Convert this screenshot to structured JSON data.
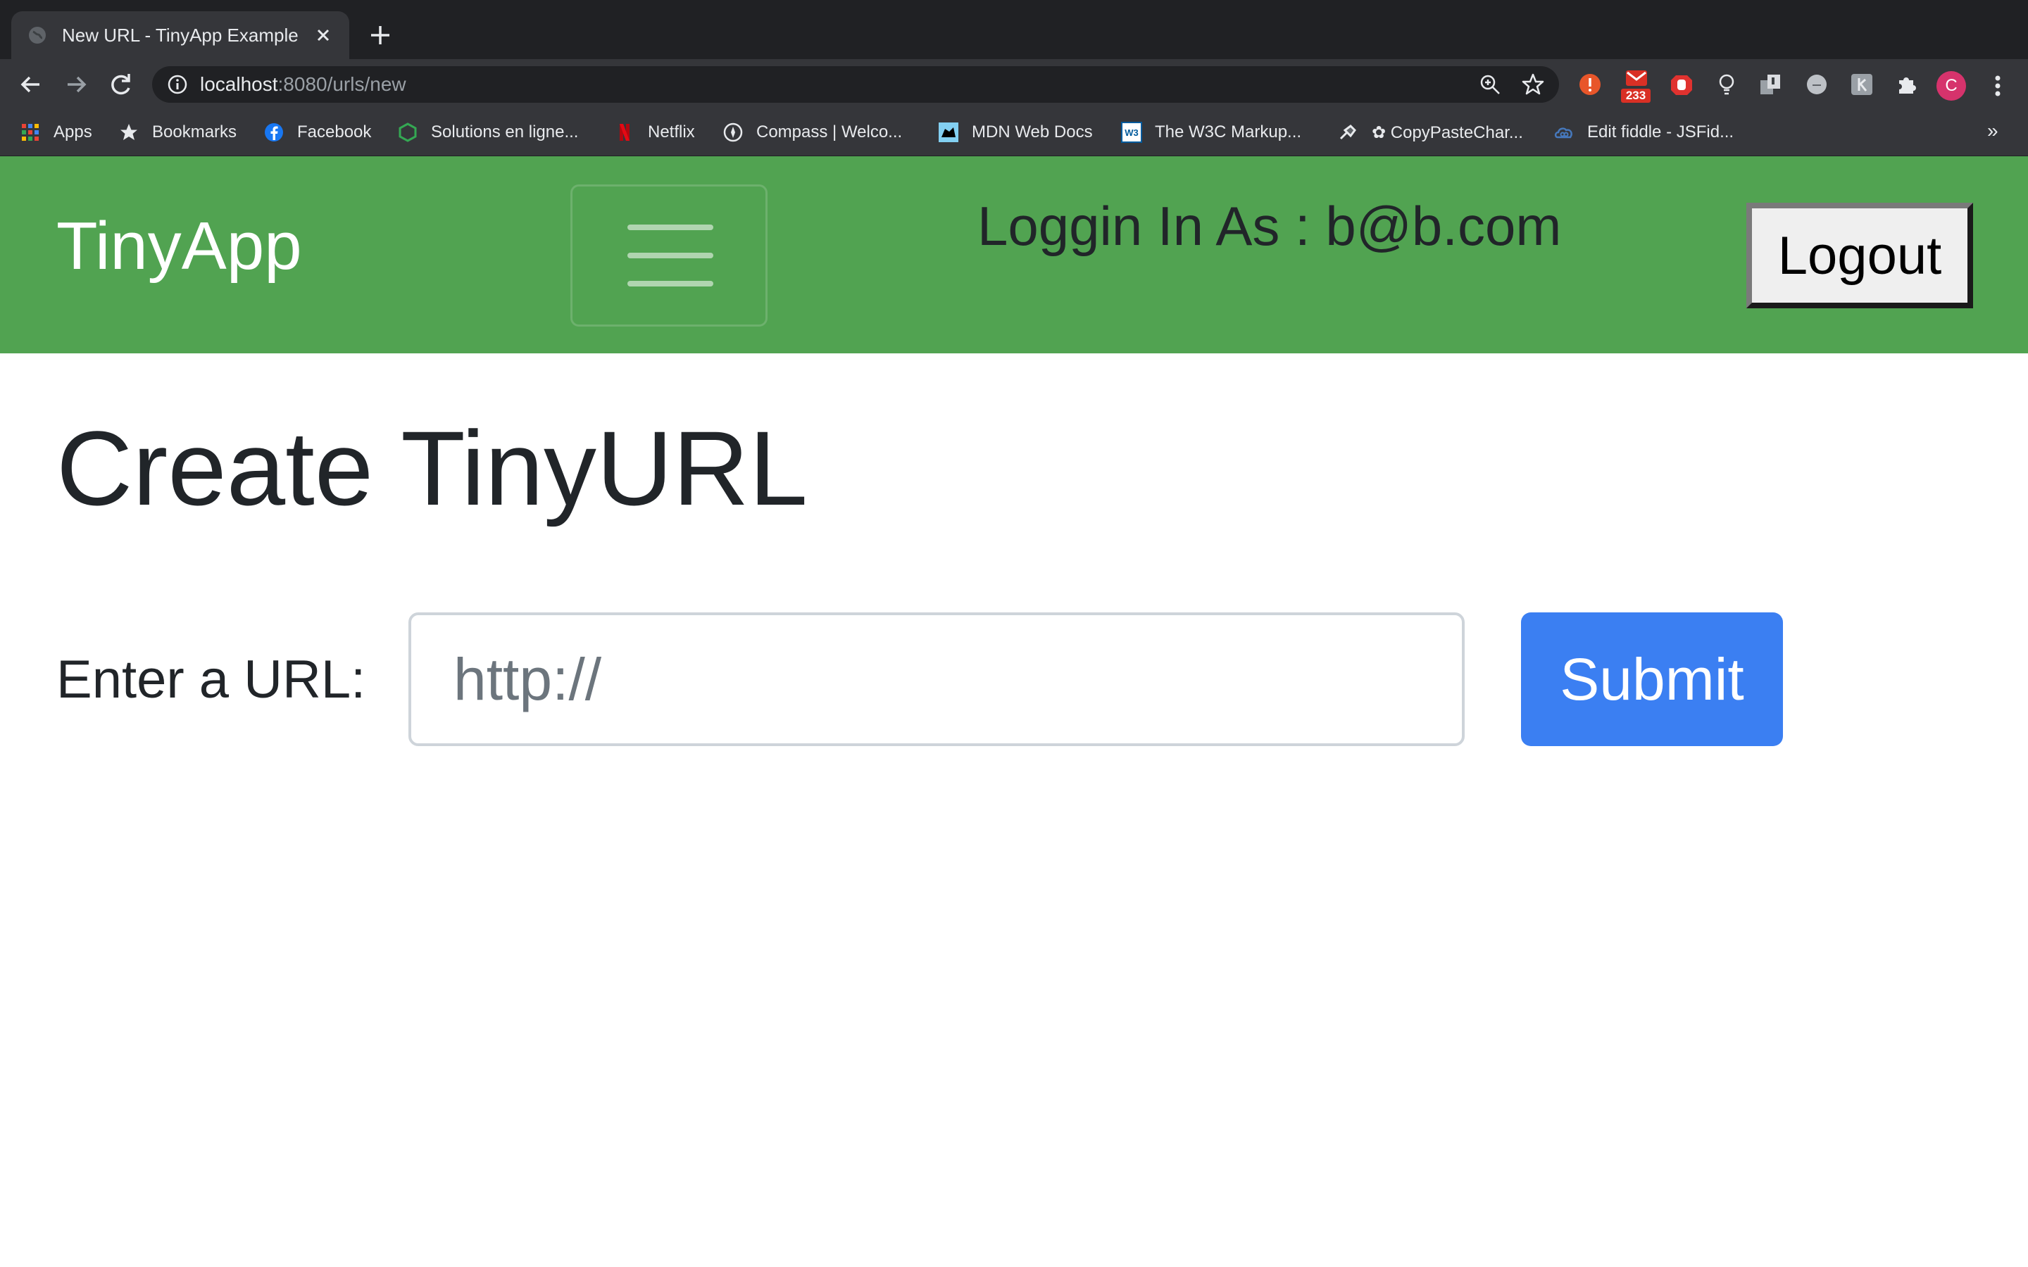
{
  "browser": {
    "tab_title": "New URL - TinyApp Example",
    "address": {
      "host": "localhost",
      "rest": ":8080/urls/new"
    },
    "extensions": [
      "alert-extension-icon",
      "mail-extension-icon",
      "hand-extension-icon",
      "bulb-extension-icon",
      "page-extension-icon",
      "circle-extension-icon",
      "k-extension-icon",
      "puzzle-icon"
    ],
    "mail_badge": "233",
    "profile_initial": "C",
    "bookmarks": [
      {
        "label": "Apps",
        "icon": "apps-grid-icon"
      },
      {
        "label": "Bookmarks",
        "icon": "star-icon"
      },
      {
        "label": "Facebook",
        "icon": "facebook-icon"
      },
      {
        "label": "Solutions en ligne...",
        "icon": "hexagon-icon"
      },
      {
        "label": "Netflix",
        "icon": "netflix-icon"
      },
      {
        "label": "Compass | Welco...",
        "icon": "compass-icon"
      },
      {
        "label": "MDN Web Docs",
        "icon": "mdn-icon"
      },
      {
        "label": "The W3C Markup...",
        "icon": "w3c-icon"
      },
      {
        "label": "✿ CopyPasteChar...",
        "icon": "copypaste-icon"
      },
      {
        "label": "Edit fiddle - JSFid...",
        "icon": "jsfiddle-icon"
      }
    ],
    "bookmarks_overflow": "»"
  },
  "navbar": {
    "brand": "TinyApp",
    "login_text": "Loggin In As : b@b.com",
    "logout_label": "Logout",
    "background": "#51a351"
  },
  "main": {
    "title": "Create TinyURL",
    "url_label": "Enter a URL:",
    "url_placeholder": "http://",
    "url_value": "",
    "submit_label": "Submit",
    "submit_color": "#3b7ff2"
  }
}
